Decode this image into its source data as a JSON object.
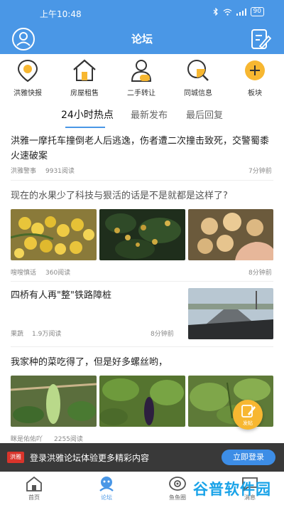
{
  "status_bar": {
    "time": "上午10:48",
    "battery": "90"
  },
  "header": {
    "title": "论坛"
  },
  "quick_menu": [
    {
      "label": "洪雅快报",
      "icon": "location-icon"
    },
    {
      "label": "房屋租售",
      "icon": "house-icon"
    },
    {
      "label": "二手转让",
      "icon": "person-icon"
    },
    {
      "label": "同城信息",
      "icon": "search-icon"
    },
    {
      "label": "板块",
      "icon": "plus-icon"
    }
  ],
  "tabs": [
    {
      "label": "24小时热点",
      "active": true
    },
    {
      "label": "最新发布",
      "active": false
    },
    {
      "label": "最后回复",
      "active": false
    }
  ],
  "posts": [
    {
      "title": "洪雅一摩托车撞倒老人后逃逸，伤者遭二次撞击致死，交警蜀黍火速破案",
      "author": "洪雅警事",
      "reads": "9931阅读",
      "time": "7分钟前"
    },
    {
      "title": "现在的水果少了科技与狠活的话是不是就都是这样了?",
      "author": "嗖嗖慎话",
      "reads": "360阅读",
      "time": "8分钟前"
    },
    {
      "title": "四桥有人再\"整\"铁路障桩",
      "author": "果蔬",
      "reads": "1.9万阅读",
      "time": "8分钟前"
    },
    {
      "title": "我家种的菜吃得了，但是好多螺丝哟，",
      "author": "眯是佑佑吖",
      "reads": "2255阅读",
      "time": ""
    }
  ],
  "fab": {
    "label": "发帖"
  },
  "login_banner": {
    "logo": "洪雅",
    "message": "登录洪雅论坛体验更多精彩内容",
    "button": "立即登录"
  },
  "bottom_nav": [
    {
      "label": "首页",
      "icon": "home-icon"
    },
    {
      "label": "论坛",
      "icon": "forum-icon",
      "active": true
    },
    {
      "label": "鱼鱼圈",
      "icon": "eye-icon"
    },
    {
      "label": "消息",
      "icon": "message-icon"
    }
  ],
  "watermark": {
    "text": "谷普软件园"
  },
  "colors": {
    "brand_blue": "#4a97e6",
    "fab_orange": "#f7b731",
    "banner_dark": "#1e1e1e"
  }
}
